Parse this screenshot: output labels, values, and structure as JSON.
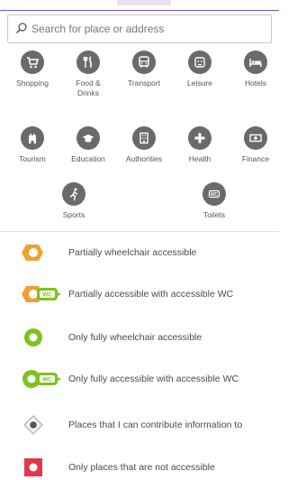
{
  "search": {
    "placeholder": "Search for place or address"
  },
  "categories": [
    {
      "label": "Shopping",
      "icon": "shopping-cart-icon"
    },
    {
      "label": "Food &\nDrinks",
      "icon": "cutlery-icon"
    },
    {
      "label": "Transport",
      "icon": "bus-icon"
    },
    {
      "label": "Leisure",
      "icon": "theater-icon"
    },
    {
      "label": "Hotels",
      "icon": "bed-icon"
    },
    {
      "label": "Tourism",
      "icon": "castle-icon"
    },
    {
      "label": "Education",
      "icon": "graduation-cap-icon"
    },
    {
      "label": "Authorities",
      "icon": "building-icon"
    },
    {
      "label": "Health",
      "icon": "plus-icon"
    },
    {
      "label": "Finance",
      "icon": "banknote-icon"
    },
    {
      "label": "Sports",
      "icon": "runner-icon"
    },
    {
      "label": "Toilets",
      "icon": "wc-icon"
    }
  ],
  "legend": [
    {
      "text": "Partially wheelchair accessible",
      "icon": "partial-marker-icon",
      "color": "#f0a030"
    },
    {
      "text": "Partially accessible with accessible WC",
      "icon": "partial-wc-marker-icon",
      "color": "#f0a030"
    },
    {
      "text": "Only fully wheelchair accessible",
      "icon": "full-marker-icon",
      "color": "#7cc31e"
    },
    {
      "text": "Only fully accessible with accessible WC",
      "icon": "full-wc-marker-icon",
      "color": "#7cc31e"
    },
    {
      "text": "Places that I can contribute information to",
      "icon": "unknown-marker-icon",
      "color": "#b5b5b5"
    },
    {
      "text": "Only places that are not accessible",
      "icon": "not-accessible-marker-icon",
      "color": "#e0384a"
    }
  ],
  "wc_label": "WC"
}
